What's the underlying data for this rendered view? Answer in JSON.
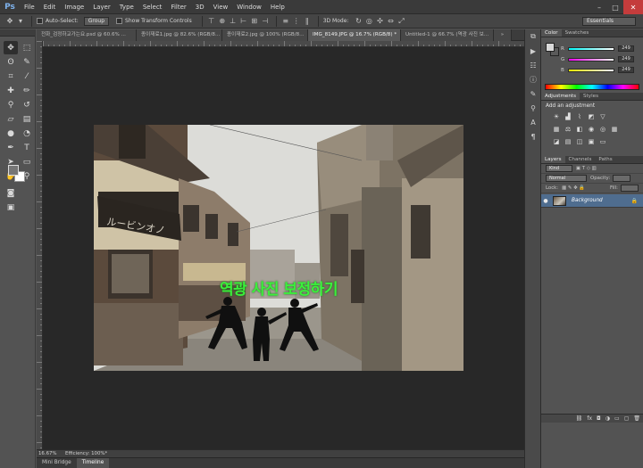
{
  "app": {
    "logo": "Ps",
    "menu": [
      "File",
      "Edit",
      "Image",
      "Layer",
      "Type",
      "Select",
      "Filter",
      "3D",
      "View",
      "Window",
      "Help"
    ],
    "window_controls": [
      "–",
      "□",
      "✕"
    ]
  },
  "options_bar": {
    "auto_select_label": "Auto-Select:",
    "auto_select_value": "Group",
    "show_transform_label": "Show Transform Controls",
    "mode_3d_label": "3D Mode:",
    "workspace": "Essentials"
  },
  "tabs": [
    {
      "label": "전화_검정하교가는요.psd @ 60.6% ...",
      "active": false
    },
    {
      "label": "종이재료1.jpg @ 82.6% (RGB/8...",
      "active": false
    },
    {
      "label": "종이재료2.jpg @ 100% (RGB/8...",
      "active": false
    },
    {
      "label": "IMG_8149.JPG @ 16.7% (RGB/8) *",
      "active": true
    },
    {
      "label": "Untitled-1 @ 66.7% (역광 사진 보...",
      "active": false
    }
  ],
  "ruler": {
    "h_labels": [
      "0",
      "100",
      "200",
      "300",
      "400",
      "500",
      "600",
      "700",
      "800",
      "900",
      "1000",
      "1100",
      "1200",
      "1300",
      "1400",
      "1500",
      "1600",
      "1700",
      "1800",
      "1900"
    ]
  },
  "canvas": {
    "overlay_text": "역광 사진 보정하기",
    "overlay_color": "#3bf03b",
    "sign_text": "ルービンオノ"
  },
  "status": {
    "zoom": "16.67%",
    "efficiency": "Efficiency: 100%*"
  },
  "bottom_tabs": [
    {
      "label": "Mini Bridge",
      "active": false
    },
    {
      "label": "Timeline",
      "active": true
    }
  ],
  "color_panel": {
    "tabs": [
      "Color",
      "Swatches"
    ],
    "sliders": [
      {
        "label": "R",
        "value": "249"
      },
      {
        "label": "G",
        "value": "249"
      },
      {
        "label": "B",
        "value": "249"
      }
    ]
  },
  "adjustments_panel": {
    "tabs": [
      "Adjustments",
      "Styles"
    ],
    "title": "Add an adjustment"
  },
  "layers_panel": {
    "tabs": [
      "Layers",
      "Channels",
      "Paths"
    ],
    "kind": "Kind",
    "blend_mode": "Normal",
    "opacity_label": "Opacity:",
    "lock_label": "Lock:",
    "fill_label": "Fill:",
    "layers": [
      {
        "name": "Background",
        "visible": true,
        "locked": true
      }
    ]
  }
}
